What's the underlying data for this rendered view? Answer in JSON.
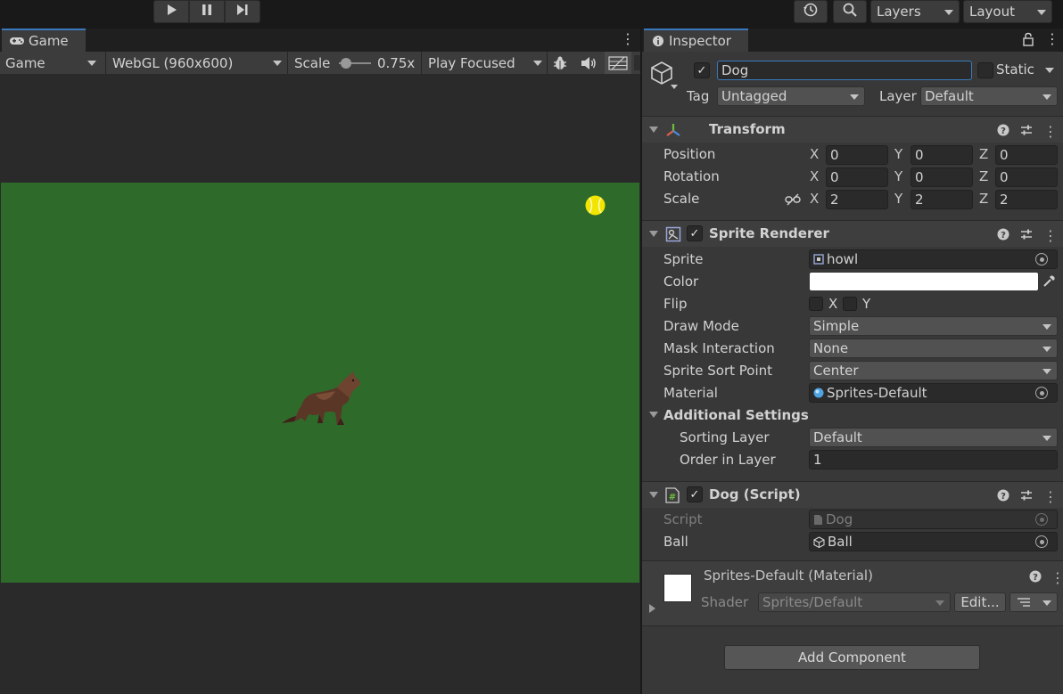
{
  "toolbar": {
    "play_icon": "play-icon",
    "pause_icon": "pause-icon",
    "step_icon": "step-icon",
    "history_icon": "history-icon",
    "search_icon": "search-icon",
    "layers_label": "Layers",
    "layout_label": "Layout"
  },
  "game_panel": {
    "tab_label": "Game",
    "display_dropdown": "Game",
    "resolution_dropdown": "WebGL (960x600)",
    "scale_label": "Scale",
    "scale_value": "0.75x",
    "scale_fraction": 0.1,
    "play_mode_dropdown": "Play Focused",
    "field_color": "#2e6b2b",
    "ball_color": "#f2e500"
  },
  "inspector": {
    "tab_label": "Inspector",
    "object": {
      "active": true,
      "name": "Dog",
      "static_label": "Static",
      "tag_label": "Tag",
      "tag_value": "Untagged",
      "layer_label": "Layer",
      "layer_value": "Default"
    },
    "transform": {
      "title": "Transform",
      "rows": [
        {
          "label": "Position",
          "x": "0",
          "y": "0",
          "z": "0"
        },
        {
          "label": "Rotation",
          "x": "0",
          "y": "0",
          "z": "0"
        },
        {
          "label": "Scale",
          "x": "2",
          "y": "2",
          "z": "2"
        }
      ],
      "axis_x": "X",
      "axis_y": "Y",
      "axis_z": "Z"
    },
    "sprite_renderer": {
      "title": "Sprite Renderer",
      "enabled": true,
      "sprite_label": "Sprite",
      "sprite_value": "howl",
      "color_label": "Color",
      "color_value": "#ffffff",
      "flip_label": "Flip",
      "flip_x": "X",
      "flip_y": "Y",
      "draw_mode_label": "Draw Mode",
      "draw_mode_value": "Simple",
      "mask_label": "Mask Interaction",
      "mask_value": "None",
      "sort_point_label": "Sprite Sort Point",
      "sort_point_value": "Center",
      "material_label": "Material",
      "material_value": "Sprites-Default",
      "additional_label": "Additional Settings",
      "sorting_layer_label": "Sorting Layer",
      "sorting_layer_value": "Default",
      "order_label": "Order in Layer",
      "order_value": "1"
    },
    "dog_script": {
      "title": "Dog (Script)",
      "enabled": true,
      "script_label": "Script",
      "script_value": "Dog",
      "ball_label": "Ball",
      "ball_value": "Ball"
    },
    "material": {
      "title": "Sprites-Default (Material)",
      "shader_label": "Shader",
      "shader_value": "Sprites/Default",
      "edit_label": "Edit..."
    },
    "add_component_label": "Add Component"
  }
}
